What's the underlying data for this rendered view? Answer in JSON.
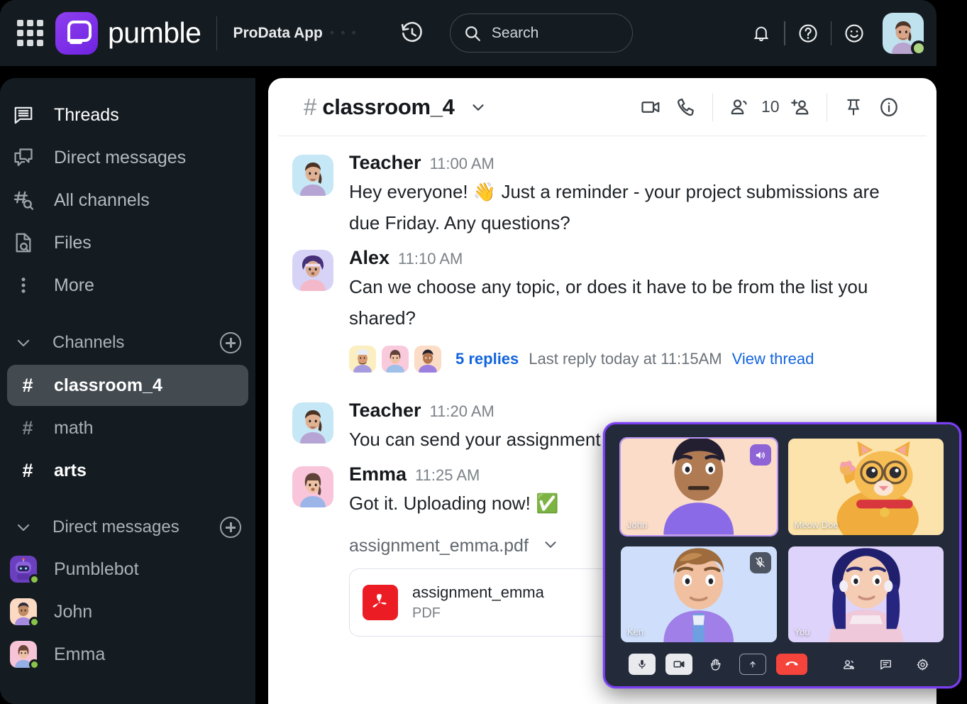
{
  "header": {
    "app_grid_icon": "app-grid-icon",
    "brand_name": "pumble",
    "workspace_name": "ProData App",
    "workspace_dots": "• • •",
    "history_icon": "history-icon",
    "search": {
      "placeholder": "Search",
      "value": "",
      "icon": "search-icon"
    },
    "icons": [
      "bell-icon",
      "help-circle-icon",
      "emoji-smiley-icon"
    ],
    "user": {
      "name": "You",
      "presence": "online",
      "presence_color": "#aed581"
    },
    "bg_color": "#151c21"
  },
  "sidebar": {
    "nav": [
      {
        "label": "Threads",
        "icon": "threads-icon",
        "active": true
      },
      {
        "label": "Direct messages",
        "icon": "direct-messages-icon",
        "active": false
      },
      {
        "label": "All channels",
        "icon": "all-channels-icon",
        "active": false
      },
      {
        "label": "Files",
        "icon": "files-icon",
        "active": false
      },
      {
        "label": "More",
        "icon": "more-vertical-icon",
        "active": false
      }
    ],
    "channels_section": {
      "title": "Channels",
      "add_icon": "plus-circle-icon",
      "chevron": "chevron-down-icon"
    },
    "channels": [
      {
        "name": "classroom_4",
        "hash": "#",
        "selected": true,
        "unread": false
      },
      {
        "name": "math",
        "hash": "#",
        "selected": false,
        "unread": false
      },
      {
        "name": "arts",
        "hash": "#",
        "selected": false,
        "unread": true
      }
    ],
    "dm_section": {
      "title": "Direct messages",
      "add_icon": "plus-circle-icon",
      "chevron": "chevron-down-icon"
    },
    "dms": [
      {
        "name": "Pumblebot",
        "presence": "online"
      },
      {
        "name": "John",
        "presence": "online"
      },
      {
        "name": "Emma",
        "presence": "online"
      }
    ]
  },
  "channel_header": {
    "hash": "#",
    "name": "classroom_4",
    "chevron": "chevron-down-icon",
    "member_count": "10",
    "icons": [
      "video-camera-icon",
      "phone-icon",
      "members-icon",
      "add-member-icon",
      "pin-icon",
      "info-circle-icon"
    ]
  },
  "messages": [
    {
      "author": "Teacher",
      "time": "11:00 AM",
      "text": "Hey everyone! 👋 Just a reminder - your project submissions are due Friday. Any questions?"
    },
    {
      "author": "Alex",
      "time": "11:10 AM",
      "text": "Can we choose any topic, or does it have to be from the list you shared?",
      "thread": {
        "replies_label": "5 replies",
        "last_reply": "Last reply today at 11:15AM",
        "view_thread": "View thread",
        "participants": 3
      }
    },
    {
      "author": "Teacher",
      "time": "11:20 AM",
      "text": "You can send your assignment"
    },
    {
      "author": "Emma",
      "time": "11:25 AM",
      "text": "Got it. Uploading now! ✅",
      "attachment": {
        "name_row": "assignment_emma.pdf",
        "chevron": "chevron-down-icon",
        "card_title": "assignment_emma",
        "card_subtitle": "PDF",
        "type_icon": "pdf-file-icon",
        "icon_color": "#eb1c24"
      }
    }
  ],
  "call_panel": {
    "accent_color": "#7b3ff2",
    "bg_color": "#232a3a",
    "tiles": [
      {
        "name": "John",
        "badge": "speaker-on-icon",
        "badge_kind": "spk",
        "bg": "#fbdcc8",
        "speaking": true
      },
      {
        "name": "Meow Doe",
        "badge": "",
        "badge_kind": "",
        "bg": "#fce3ab",
        "speaking": false
      },
      {
        "name": "Ken",
        "badge": "mic-off-icon",
        "badge_kind": "mut",
        "bg": "#cfdffb",
        "speaking": false
      },
      {
        "name": "You",
        "badge": "",
        "badge_kind": "",
        "bg": "#ded3fa",
        "speaking": false
      }
    ],
    "controls": [
      {
        "icon": "microphone-icon",
        "style": "light"
      },
      {
        "icon": "video-camera-icon",
        "style": "light"
      },
      {
        "icon": "raise-hand-icon",
        "style": "plain"
      },
      {
        "icon": "share-screen-icon",
        "style": "outline"
      },
      {
        "icon": "hang-up-icon",
        "style": "hang"
      },
      {
        "icon": "participants-icon",
        "style": "plain"
      },
      {
        "icon": "chat-icon",
        "style": "plain"
      },
      {
        "icon": "settings-gear-icon",
        "style": "plain"
      }
    ]
  }
}
